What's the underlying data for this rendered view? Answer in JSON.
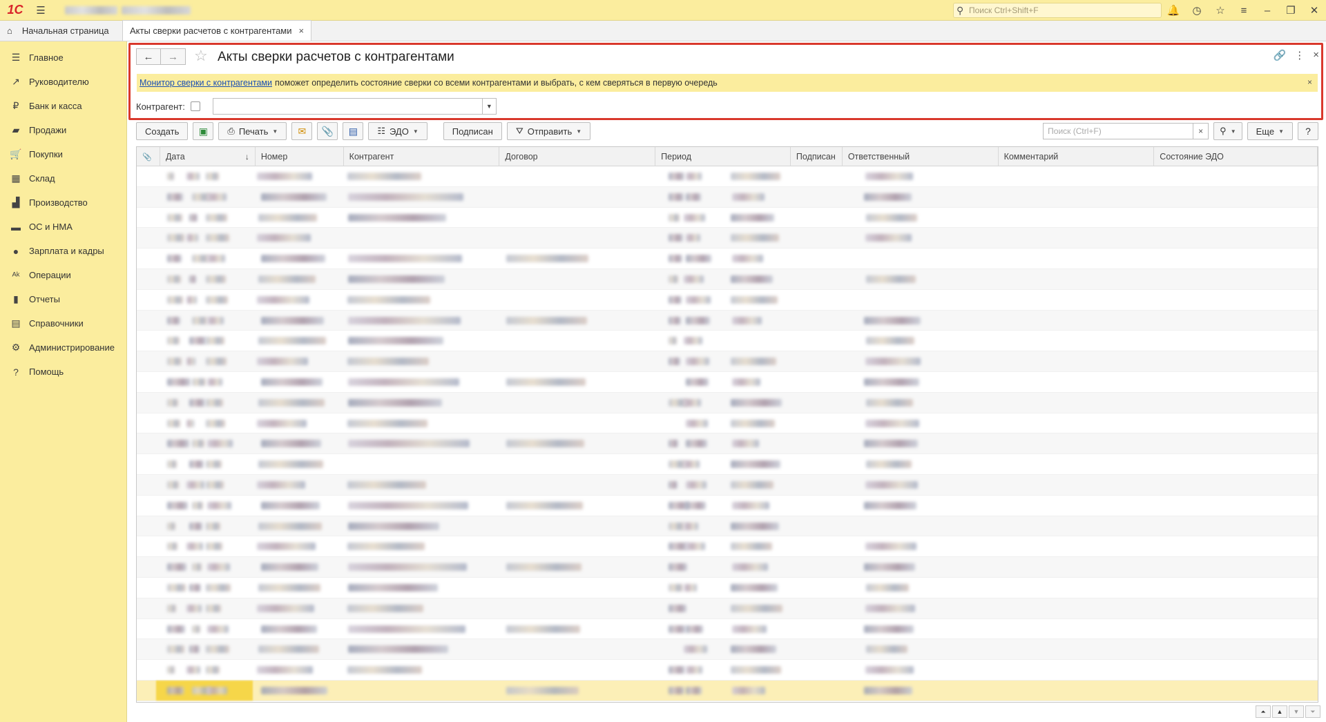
{
  "topbar": {
    "logo": "1С",
    "search_placeholder": "Поиск Ctrl+Shift+F",
    "menu_icon": "hamburger-icon",
    "right_icons": [
      "bell-icon",
      "history-icon",
      "star-icon",
      "settings-list-icon",
      "minimize-icon",
      "restore-icon",
      "close-icon"
    ]
  },
  "tabs": {
    "home_label": "Начальная страница",
    "active_label": "Акты сверки расчетов с контрагентами",
    "close_glyph": "×"
  },
  "sidebar": {
    "items": [
      {
        "label": "Главное",
        "icon": "☰"
      },
      {
        "label": "Руководителю",
        "icon": "↗"
      },
      {
        "label": "Банк и касса",
        "icon": "₽"
      },
      {
        "label": "Продажи",
        "icon": "▰"
      },
      {
        "label": "Покупки",
        "icon": "🛒"
      },
      {
        "label": "Склад",
        "icon": "▦"
      },
      {
        "label": "Производство",
        "icon": "▟"
      },
      {
        "label": "ОС и НМА",
        "icon": "▬"
      },
      {
        "label": "Зарплата и кадры",
        "icon": "●"
      },
      {
        "label": "Операции",
        "icon": "ᴬᵏ"
      },
      {
        "label": "Отчеты",
        "icon": "▮"
      },
      {
        "label": "Справочники",
        "icon": "▤"
      },
      {
        "label": "Администрирование",
        "icon": "⚙"
      },
      {
        "label": "Помощь",
        "icon": "?"
      }
    ]
  },
  "form": {
    "title": "Акты сверки расчетов с контрагентами",
    "back_glyph": "←",
    "forward_glyph": "→",
    "star_glyph": "☆",
    "link_glyph": "🔗",
    "more_glyph": "⋮",
    "close_glyph": "×",
    "info_link": "Монитор сверки с контрагентами",
    "info_text": "поможет определить состояние сверки со всеми контрагентами и выбрать, с кем сверяться в первую очередь",
    "info_close": "×",
    "filter_label": "Контрагент:",
    "filter_value": ""
  },
  "toolbar": {
    "create": "Создать",
    "print": "Печать",
    "edo": "ЭДО",
    "signed": "Подписан",
    "send": "Отправить",
    "search_placeholder": "Поиск (Ctrl+F)",
    "search_clear": "×",
    "more": "Еще",
    "help": "?"
  },
  "table": {
    "columns": [
      "",
      "Дата",
      "Номер",
      "Контрагент",
      "Договор",
      "Период",
      "Подписан",
      "Ответственный",
      "Комментарий",
      "Состояние ЭДО"
    ],
    "sort_glyph": "↓",
    "row_count": 26,
    "selected_row": 25
  },
  "pager": [
    "⏶",
    "▲",
    "▼",
    "⏷"
  ]
}
